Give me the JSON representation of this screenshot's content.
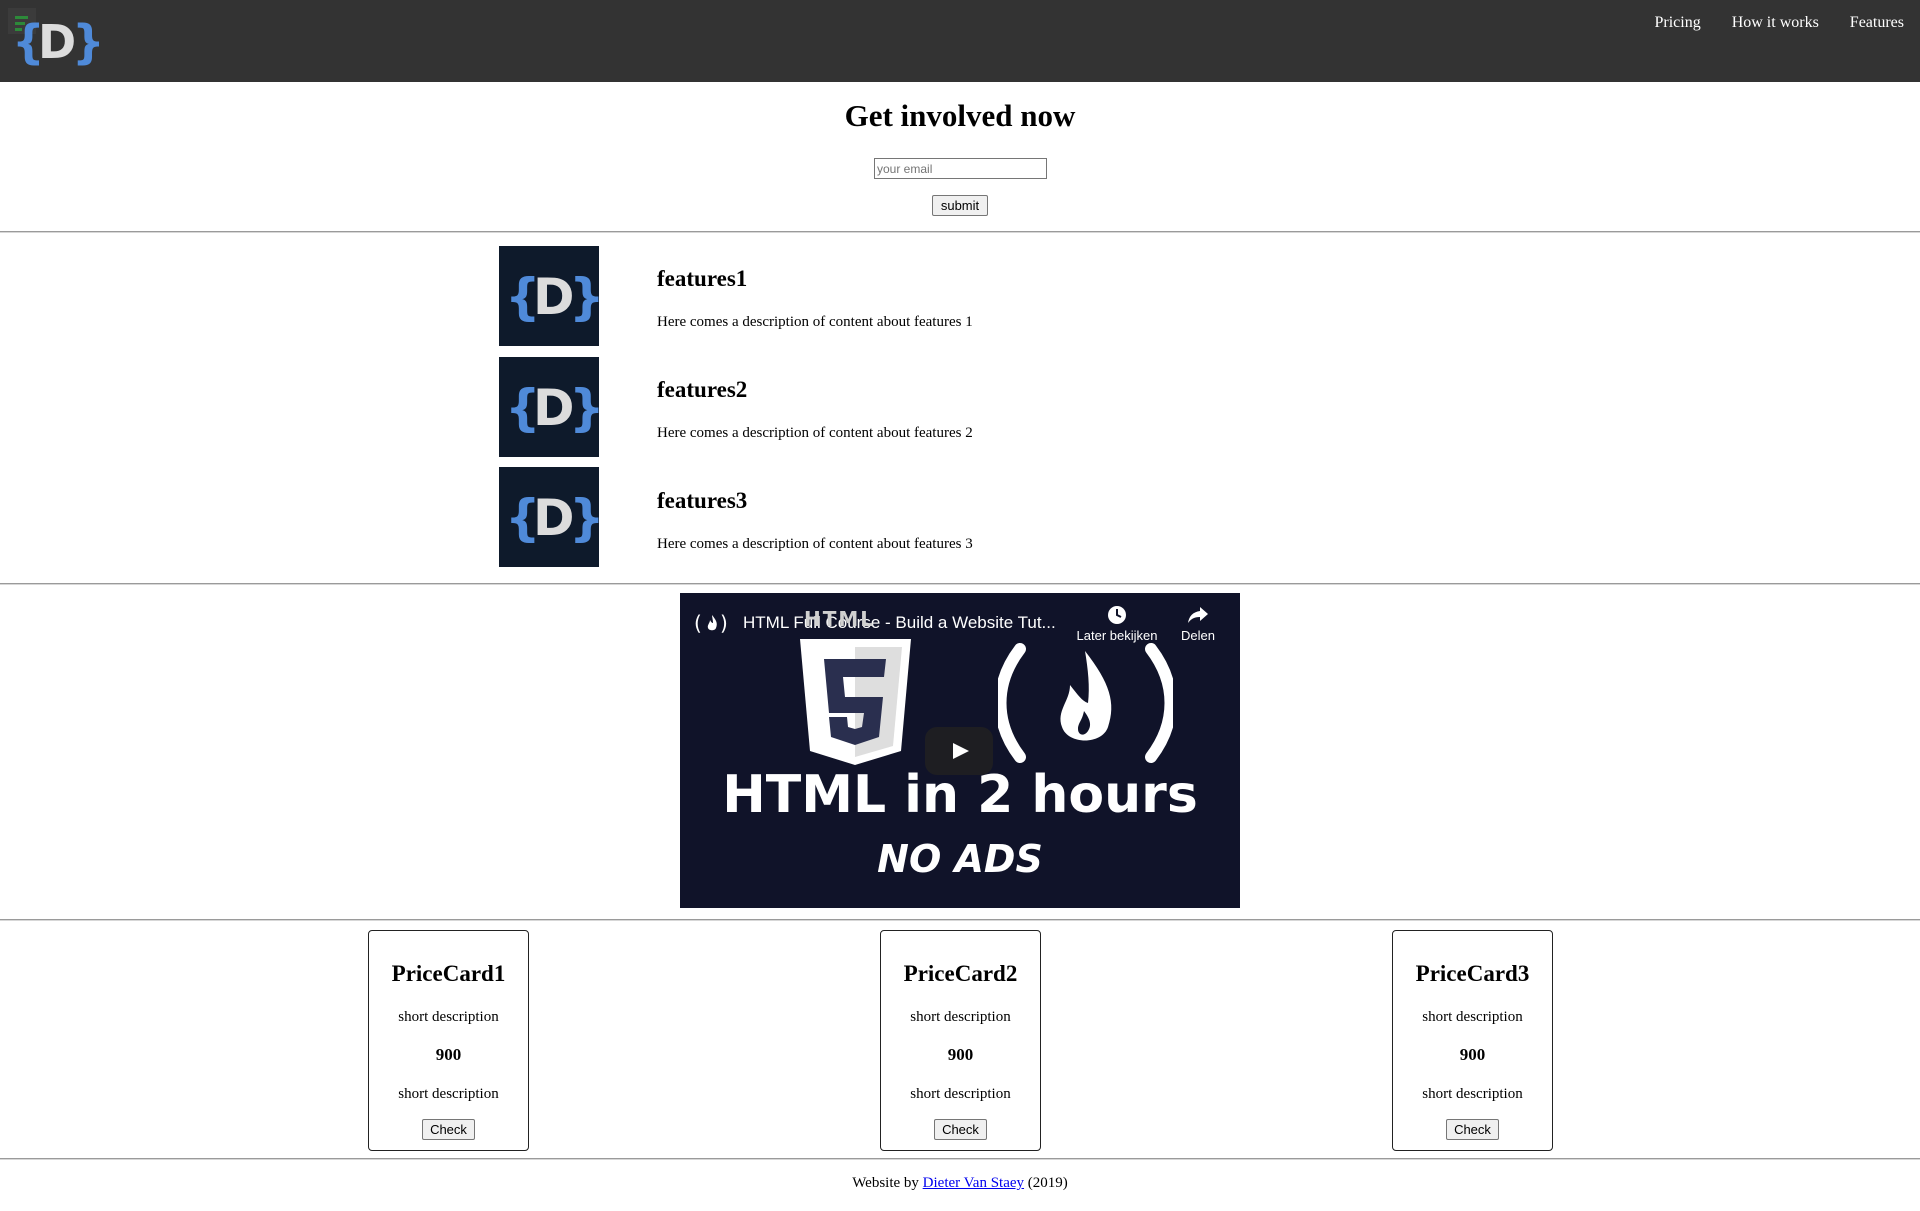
{
  "header": {
    "logo_text": "{D}",
    "nav": [
      "Pricing",
      "How it works",
      "Features"
    ]
  },
  "hero": {
    "title": "Get involved now",
    "email_placeholder": "your email",
    "submit_label": "submit"
  },
  "features": [
    {
      "icon_text": "{D}",
      "title": "features1",
      "description": "Here comes a description of content about features 1"
    },
    {
      "icon_text": "{D}",
      "title": "features2",
      "description": "Here comes a description of content about features 2"
    },
    {
      "icon_text": "{D}",
      "title": "features3",
      "description": "Here comes a description of content about features 3"
    }
  ],
  "video": {
    "title": "HTML Full Course - Build a Website Tut...",
    "watch_later": "Later bekijken",
    "share": "Delen",
    "thumb_badge": "5",
    "thumb_headline": "HTML in 2 hours",
    "thumb_subline": "NO ADS"
  },
  "pricing": [
    {
      "title": "PriceCard1",
      "desc1": "short description",
      "price": "900",
      "desc2": "short description",
      "button": "Check"
    },
    {
      "title": "PriceCard2",
      "desc1": "short description",
      "price": "900",
      "desc2": "short description",
      "button": "Check"
    },
    {
      "title": "PriceCard3",
      "desc1": "short description",
      "price": "900",
      "desc2": "short description",
      "button": "Check"
    }
  ],
  "footer": {
    "prefix": "Website by ",
    "author": "Dieter Van Staey",
    "suffix": " (2019)"
  },
  "colors": {
    "header_bg": "#333333",
    "logo_blue": "#4f8ad9",
    "logo_grey": "#dcdcdc",
    "feature_bg": "#0e1a2b",
    "video_bg": "#101329",
    "link": "#0000ee"
  }
}
